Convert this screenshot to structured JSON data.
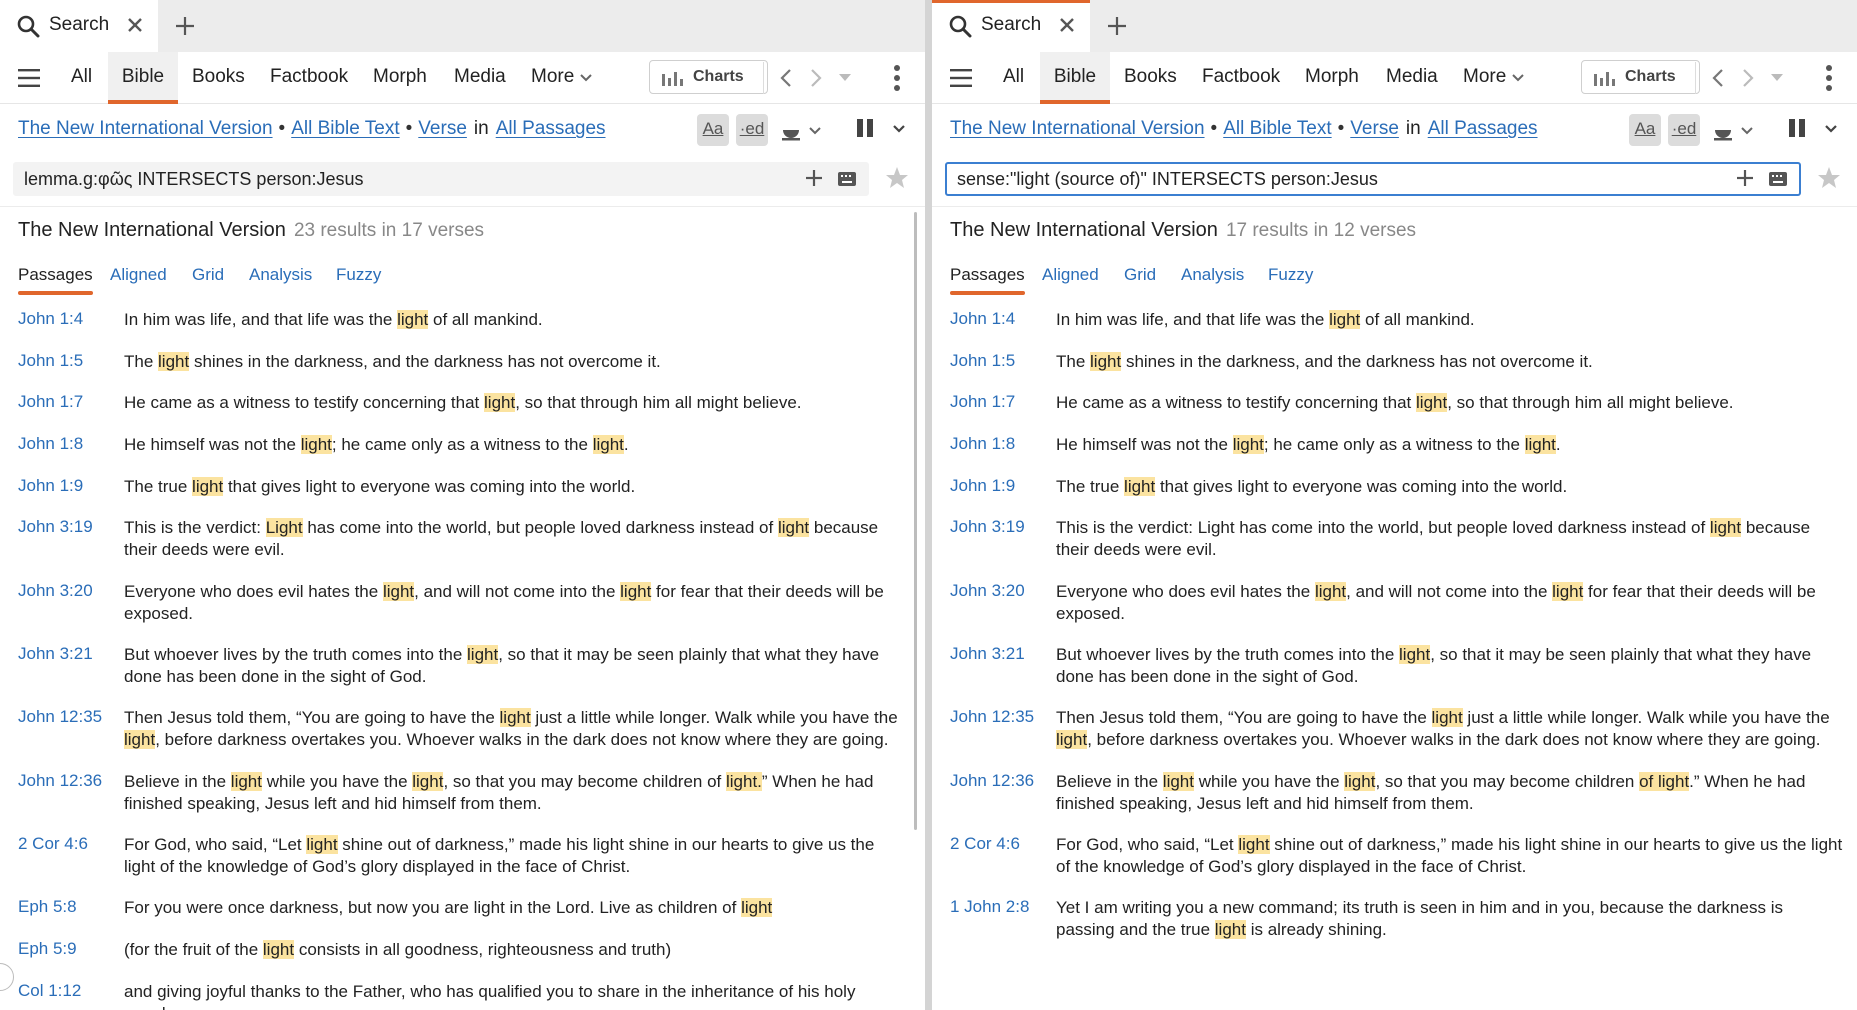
{
  "colors": {
    "accent": "#e0662c",
    "link": "#2a6db8",
    "highlight": "#fbe3a0",
    "focus": "#3b7fd1"
  },
  "left": {
    "tab": {
      "label": "Search"
    },
    "nav": [
      "All",
      "Bible",
      "Books",
      "Factbook",
      "Morph",
      "Media",
      "More"
    ],
    "charts_label": "Charts",
    "crumbs": {
      "version": "The New International Version",
      "scope": "All Bible Text",
      "unit": "Verse",
      "in": "in",
      "range": "All Passages"
    },
    "toggles": {
      "aa": "Aa",
      "ed": "·ed"
    },
    "query": "lemma.g:φῶς INTERSECTS person:Jesus",
    "results_title": "The New International Version",
    "results_count": "23 results in 17 verses",
    "subtabs": [
      "Passages",
      "Aligned",
      "Grid",
      "Analysis",
      "Fuzzy"
    ],
    "rows": [
      {
        "ref": "John 1:4",
        "parts": [
          [
            "In him was life, and that life was the ",
            0
          ],
          [
            "light",
            1
          ],
          [
            " of all mankind.",
            0
          ]
        ]
      },
      {
        "ref": "John 1:5",
        "parts": [
          [
            "The ",
            0
          ],
          [
            "light",
            1
          ],
          [
            " shines in the darkness, and the darkness has not overcome it.",
            0
          ]
        ]
      },
      {
        "ref": "John 1:7",
        "parts": [
          [
            "He came as a witness to testify concerning that ",
            0
          ],
          [
            "light",
            1
          ],
          [
            ", so that through him all might believe.",
            0
          ]
        ]
      },
      {
        "ref": "John 1:8",
        "parts": [
          [
            "He himself was not the ",
            0
          ],
          [
            "light",
            1
          ],
          [
            "; he came only as a witness to the ",
            0
          ],
          [
            "light",
            1
          ],
          [
            ".",
            0
          ]
        ]
      },
      {
        "ref": "John 1:9",
        "parts": [
          [
            "The true ",
            0
          ],
          [
            "light",
            1
          ],
          [
            " that gives light to everyone was coming into the world.",
            0
          ]
        ]
      },
      {
        "ref": "John 3:19",
        "parts": [
          [
            "This is the verdict: ",
            0
          ],
          [
            "Light",
            1
          ],
          [
            " has come into the world, but people loved darkness instead of ",
            0
          ],
          [
            "light",
            1
          ],
          [
            " because their deeds were evil.",
            0
          ]
        ]
      },
      {
        "ref": "John 3:20",
        "parts": [
          [
            "Everyone who does evil hates the ",
            0
          ],
          [
            "light",
            1
          ],
          [
            ", and will not come into the ",
            0
          ],
          [
            "light",
            1
          ],
          [
            " for fear that their deeds will be exposed.",
            0
          ]
        ]
      },
      {
        "ref": "John 3:21",
        "parts": [
          [
            "But whoever lives by the truth comes into the ",
            0
          ],
          [
            "light",
            1
          ],
          [
            ", so that it may be seen plainly that what they have done has been done in the sight of God.",
            0
          ]
        ]
      },
      {
        "ref": "John 12:35",
        "parts": [
          [
            "Then Jesus told them, “You are going to have the ",
            0
          ],
          [
            "light",
            1
          ],
          [
            " just a little while longer. Walk while you have the ",
            0
          ],
          [
            "light",
            1
          ],
          [
            ", before darkness overtakes you. Whoever walks in the dark does not know where they are going.",
            0
          ]
        ]
      },
      {
        "ref": "John 12:36",
        "parts": [
          [
            "Believe in the ",
            0
          ],
          [
            "light",
            1
          ],
          [
            " while you have the ",
            0
          ],
          [
            "light",
            1
          ],
          [
            ", so that you may become children of ",
            0
          ],
          [
            "light.",
            1
          ],
          [
            "” When he had finished speaking, Jesus left and hid himself from them.",
            0
          ]
        ]
      },
      {
        "ref": "2 Cor 4:6",
        "parts": [
          [
            "For God, who said, “Let ",
            0
          ],
          [
            "light",
            1
          ],
          [
            " shine out of darkness,” made his light shine in our hearts to give us the light of the knowledge of God’s glory displayed in the face of Christ.",
            0
          ]
        ]
      },
      {
        "ref": "Eph 5:8",
        "parts": [
          [
            "For you were once darkness, but now you are light in the Lord. Live as children of ",
            0
          ],
          [
            "light",
            1
          ]
        ]
      },
      {
        "ref": "Eph 5:9",
        "parts": [
          [
            "(for the fruit of the ",
            0
          ],
          [
            "light",
            1
          ],
          [
            " consists in all goodness, righteousness and truth)",
            0
          ]
        ]
      },
      {
        "ref": "Col 1:12",
        "parts": [
          [
            "and giving joyful thanks to the Father, who has qualified you to share in the inheritance of his holy people",
            0
          ]
        ]
      }
    ]
  },
  "right": {
    "tab": {
      "label": "Search"
    },
    "nav": [
      "All",
      "Bible",
      "Books",
      "Factbook",
      "Morph",
      "Media",
      "More"
    ],
    "charts_label": "Charts",
    "crumbs": {
      "version": "The New International Version",
      "scope": "All Bible Text",
      "unit": "Verse",
      "in": "in",
      "range": "All Passages"
    },
    "toggles": {
      "aa": "Aa",
      "ed": "·ed"
    },
    "query": "sense:\"light (source of)\" INTERSECTS person:Jesus",
    "results_title": "The New International Version",
    "results_count": "17 results in 12 verses",
    "subtabs": [
      "Passages",
      "Aligned",
      "Grid",
      "Analysis",
      "Fuzzy"
    ],
    "rows": [
      {
        "ref": "John 1:4",
        "parts": [
          [
            "In him was life, and that life was the ",
            0
          ],
          [
            "light",
            1
          ],
          [
            " of all mankind.",
            0
          ]
        ]
      },
      {
        "ref": "John 1:5",
        "parts": [
          [
            "The ",
            0
          ],
          [
            "light",
            1
          ],
          [
            " shines in the darkness, and the darkness has not overcome it.",
            0
          ]
        ]
      },
      {
        "ref": "John 1:7",
        "parts": [
          [
            "He came as a witness to testify concerning that ",
            0
          ],
          [
            "light",
            1
          ],
          [
            ", so that through him all might believe.",
            0
          ]
        ]
      },
      {
        "ref": "John 1:8",
        "parts": [
          [
            "He himself was not the ",
            0
          ],
          [
            "light",
            1
          ],
          [
            "; he came only as a witness to the ",
            0
          ],
          [
            "light",
            1
          ],
          [
            ".",
            0
          ]
        ]
      },
      {
        "ref": "John 1:9",
        "parts": [
          [
            "The true ",
            0
          ],
          [
            "light",
            1
          ],
          [
            " that gives light to everyone was coming into the world.",
            0
          ]
        ]
      },
      {
        "ref": "John 3:19",
        "parts": [
          [
            "This is the verdict: Light has come into the world, but people loved darkness instead of ",
            0
          ],
          [
            "light",
            1
          ],
          [
            " because their deeds were evil.",
            0
          ]
        ]
      },
      {
        "ref": "John 3:20",
        "parts": [
          [
            "Everyone who does evil hates the ",
            0
          ],
          [
            "light",
            1
          ],
          [
            ", and will not come into the ",
            0
          ],
          [
            "light",
            1
          ],
          [
            " for fear that their deeds will be exposed.",
            0
          ]
        ]
      },
      {
        "ref": "John 3:21",
        "parts": [
          [
            "But whoever lives by the truth comes into the ",
            0
          ],
          [
            "light",
            1
          ],
          [
            ", so that it may be seen plainly that what they have done has been done in the sight of God.",
            0
          ]
        ]
      },
      {
        "ref": "John 12:35",
        "parts": [
          [
            "Then Jesus told them, “You are going to have the ",
            0
          ],
          [
            "light",
            1
          ],
          [
            " just a little while longer. Walk while you have the ",
            0
          ],
          [
            "light",
            1
          ],
          [
            ", before darkness overtakes you. Whoever walks in the dark does not know where they are going.",
            0
          ]
        ]
      },
      {
        "ref": "John 12:36",
        "parts": [
          [
            "Believe in the ",
            0
          ],
          [
            "light",
            1
          ],
          [
            " while you have the ",
            0
          ],
          [
            "light",
            1
          ],
          [
            ", so that you may become children ",
            0
          ],
          [
            "of light",
            1
          ],
          [
            ".” When he had finished speaking, Jesus left and hid himself from them.",
            0
          ]
        ]
      },
      {
        "ref": "2 Cor 4:6",
        "parts": [
          [
            "For God, who said, “Let ",
            0
          ],
          [
            "light",
            1
          ],
          [
            " shine out of darkness,” made his light shine in our hearts to give us the light of the knowledge of God’s glory displayed in the face of Christ.",
            0
          ]
        ]
      },
      {
        "ref": "1 John 2:8",
        "parts": [
          [
            "Yet I am writing you a new command; its truth is seen in him and in you, because the darkness is passing and the true ",
            0
          ],
          [
            "light",
            1
          ],
          [
            " is already shining.",
            0
          ]
        ]
      }
    ]
  }
}
